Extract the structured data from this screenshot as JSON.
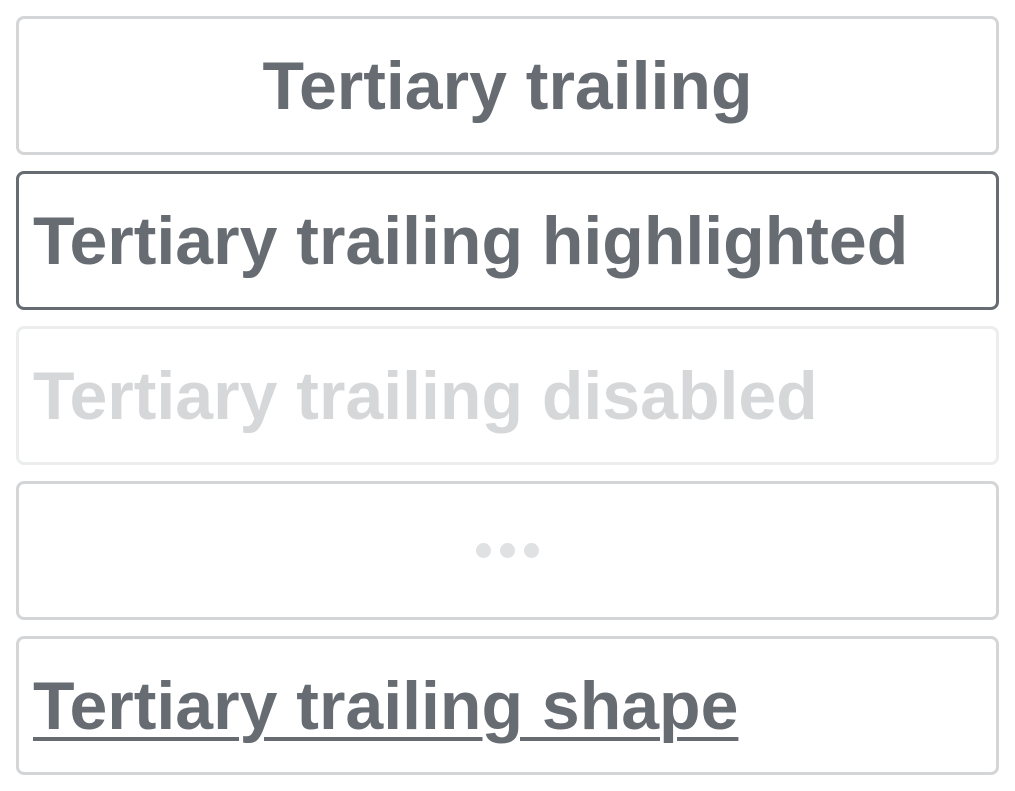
{
  "buttons": [
    {
      "label": "Tertiary trailing",
      "state": "default"
    },
    {
      "label": "Tertiary trailing highlighted",
      "state": "highlighted"
    },
    {
      "label": "Tertiary trailing disabled",
      "state": "disabled"
    },
    {
      "label": "",
      "state": "loading",
      "icon": "loading-dots-icon"
    },
    {
      "label": "Tertiary trailing shape",
      "state": "shape"
    }
  ],
  "colors": {
    "text": "#676c73",
    "border": "#d4d5d7",
    "highlight_border": "#676c73",
    "disabled_text": "#d6d7d9",
    "disabled_border": "#eceeee",
    "loading_dot": "#e0e1e3"
  }
}
